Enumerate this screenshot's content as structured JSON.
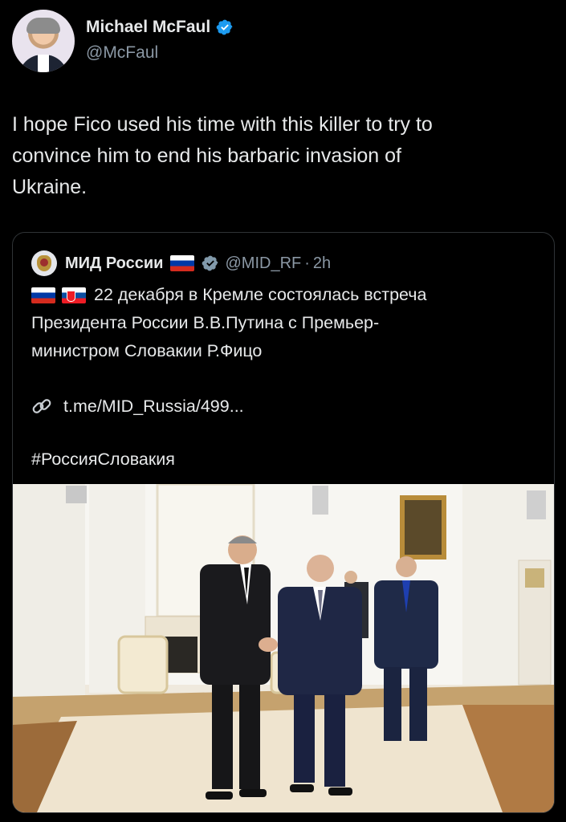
{
  "author": {
    "name": "Michael McFaul",
    "handle": "@McFaul"
  },
  "tweet": {
    "lines": [
      "I hope Fico used his time with this killer to try to",
      "convince him to end his barbaric invasion of",
      "Ukraine."
    ]
  },
  "quoted": {
    "name": "МИД России",
    "handle": "@MID_RF",
    "separator": "·",
    "time": "2h",
    "lines": [
      "22 декабря в Кремле состоялась встреча",
      "Президента России В.В.Путина с Премьер-",
      "министром Словакии Р.Фицо"
    ],
    "link": "t.me/MID_Russia/499...",
    "hashtag": "#РоссияСловакия"
  },
  "colors": {
    "background": "#000000",
    "text": "#e7e9ea",
    "secondary": "#8b98a5",
    "verified_blue": "#1d9bf0",
    "verified_gray": "#829aab",
    "border": "#2f3336"
  },
  "icons": [
    "verified-badge-icon",
    "russia-flag-icon",
    "slovakia-flag-icon",
    "link-icon"
  ]
}
